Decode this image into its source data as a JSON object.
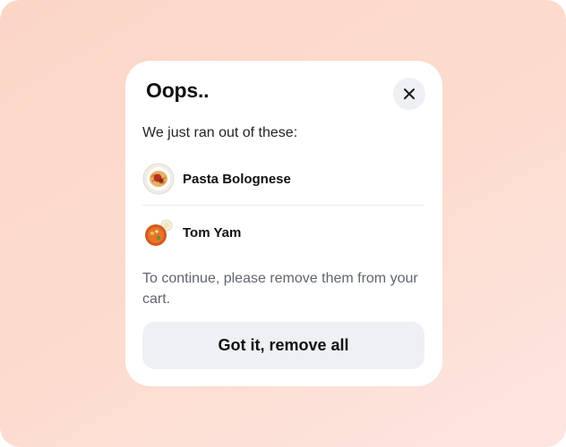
{
  "dialog": {
    "title": "Oops..",
    "subtitle": "We just ran out of these:",
    "items": [
      {
        "label": "Pasta Bolognese",
        "icon": "pasta-icon"
      },
      {
        "label": "Tom Yam",
        "icon": "tom-yam-icon"
      }
    ],
    "note": "To continue, please remove them from your cart.",
    "primary_button": "Got it, remove all",
    "close_icon": "close-icon"
  },
  "colors": {
    "backdrop": "#fbd6c7",
    "surface": "#ffffff",
    "button_bg": "#eef0f3",
    "text_primary": "#111111",
    "text_secondary": "#5f666e"
  }
}
